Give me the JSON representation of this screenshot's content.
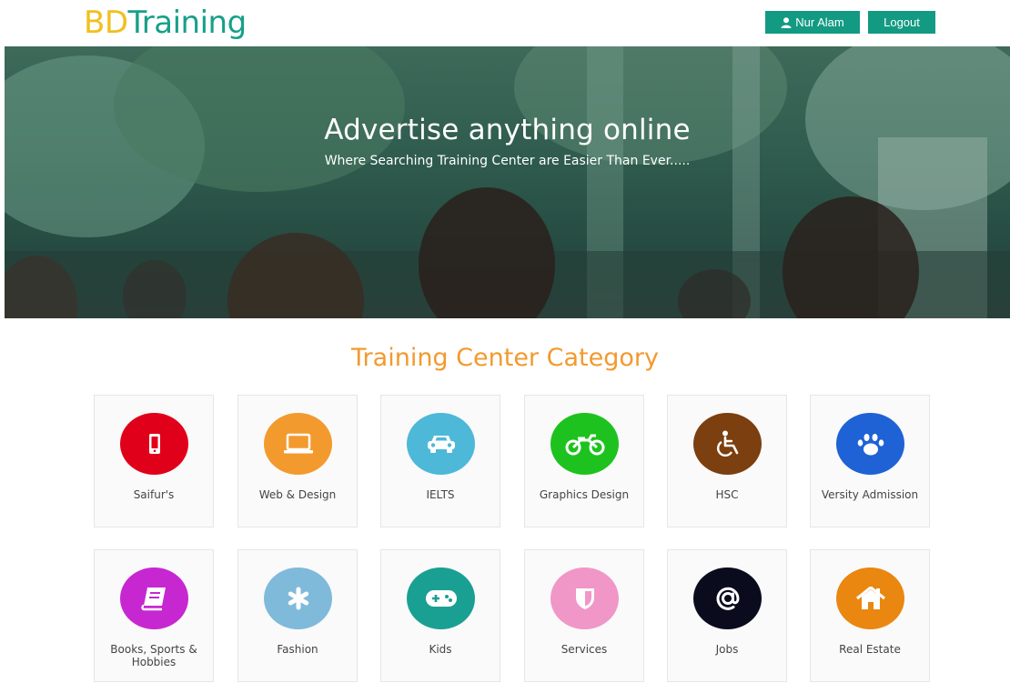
{
  "header": {
    "logo_part1": "BD",
    "logo_part2": "Training",
    "user_label": "Nur Alam",
    "logout_label": "Logout"
  },
  "hero": {
    "title": "Advertise anything online",
    "subtitle": "Where Searching Training Center are Easier Than Ever....."
  },
  "categories": {
    "title": "Training Center Category",
    "items": [
      {
        "label": "Saifur's",
        "icon": "mobile-phone-icon",
        "color": "#e1001a"
      },
      {
        "label": "Web & Design",
        "icon": "laptop-icon",
        "color": "#f39a2e"
      },
      {
        "label": "IELTS",
        "icon": "car-icon",
        "color": "#4db8d8"
      },
      {
        "label": "Graphics Design",
        "icon": "motorcycle-icon",
        "color": "#1ec21e"
      },
      {
        "label": "HSC",
        "icon": "wheelchair-icon",
        "color": "#7b3f10"
      },
      {
        "label": "Versity Admission",
        "icon": "paw-icon",
        "color": "#1f62d6"
      },
      {
        "label": "Books, Sports & Hobbies",
        "icon": "book-icon",
        "color": "#c727d1"
      },
      {
        "label": "Fashion",
        "icon": "asterisk-icon",
        "color": "#7fbadb"
      },
      {
        "label": "Kids",
        "icon": "gamepad-icon",
        "color": "#1aa093"
      },
      {
        "label": "Services",
        "icon": "shield-icon",
        "color": "#f097c8"
      },
      {
        "label": "Jobs",
        "icon": "at-sign-icon",
        "color": "#0b0b1e"
      },
      {
        "label": "Real Estate",
        "icon": "home-icon",
        "color": "#ea8710"
      }
    ]
  }
}
